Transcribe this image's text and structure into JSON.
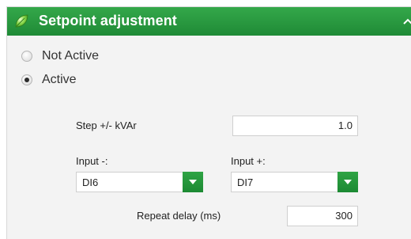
{
  "panel": {
    "title": "Setpoint adjustment",
    "header_color": "#229a3c"
  },
  "mode": {
    "options": [
      {
        "label": "Not Active",
        "checked": false
      },
      {
        "label": "Active",
        "checked": true
      }
    ]
  },
  "step": {
    "label": "Step +/- kVAr",
    "value": "1.0"
  },
  "input_minus": {
    "label": "Input -:",
    "value": "DI6"
  },
  "input_plus": {
    "label": "Input +:",
    "value": "DI7"
  },
  "repeat_delay": {
    "label": "Repeat delay (ms)",
    "value": "300"
  },
  "icons": {
    "header": "leaf-icon",
    "collapse": "chevron-up-icon",
    "dropdown": "chevron-down-icon"
  }
}
